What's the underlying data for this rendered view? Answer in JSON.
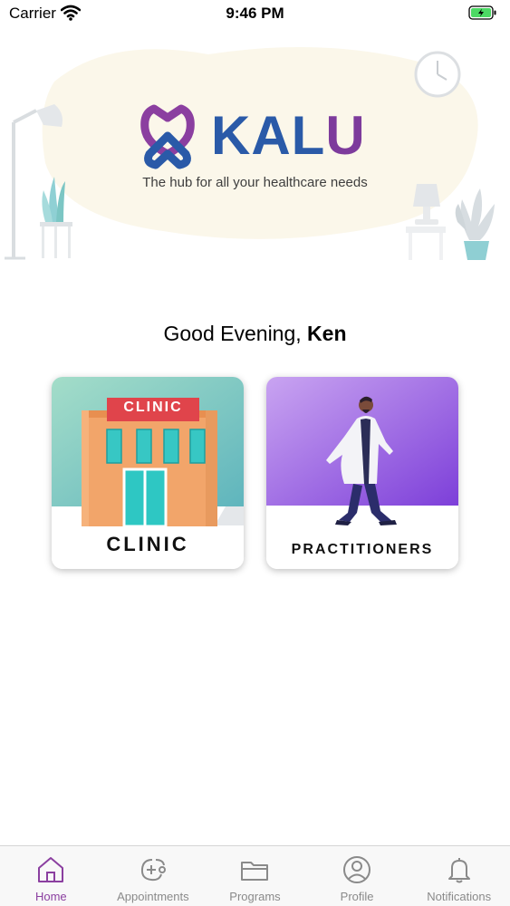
{
  "status_bar": {
    "carrier": "Carrier",
    "time": "9:46 PM"
  },
  "brand": {
    "name_part1": "KAL",
    "name_part2": "U",
    "tagline": "The hub for all your healthcare needs"
  },
  "greeting": {
    "prefix": "Good Evening,",
    "name": "Ken"
  },
  "cards": [
    {
      "label": "CLINIC",
      "sign": "CLINIC"
    },
    {
      "label": "PRACTITIONERS"
    }
  ],
  "tabs": [
    {
      "label": "Home",
      "icon": "home-icon",
      "active": true
    },
    {
      "label": "Appointments",
      "icon": "stethoscope-icon",
      "active": false
    },
    {
      "label": "Programs",
      "icon": "folder-icon",
      "active": false
    },
    {
      "label": "Profile",
      "icon": "profile-icon",
      "active": false
    },
    {
      "label": "Notifications",
      "icon": "bell-icon",
      "active": false
    }
  ],
  "colors": {
    "brand_blue": "#2a5aa8",
    "brand_purple": "#7d3b9c",
    "active_tab": "#8b3fa0",
    "inactive_tab": "#8a8a8a",
    "battery": "#4cd964"
  }
}
